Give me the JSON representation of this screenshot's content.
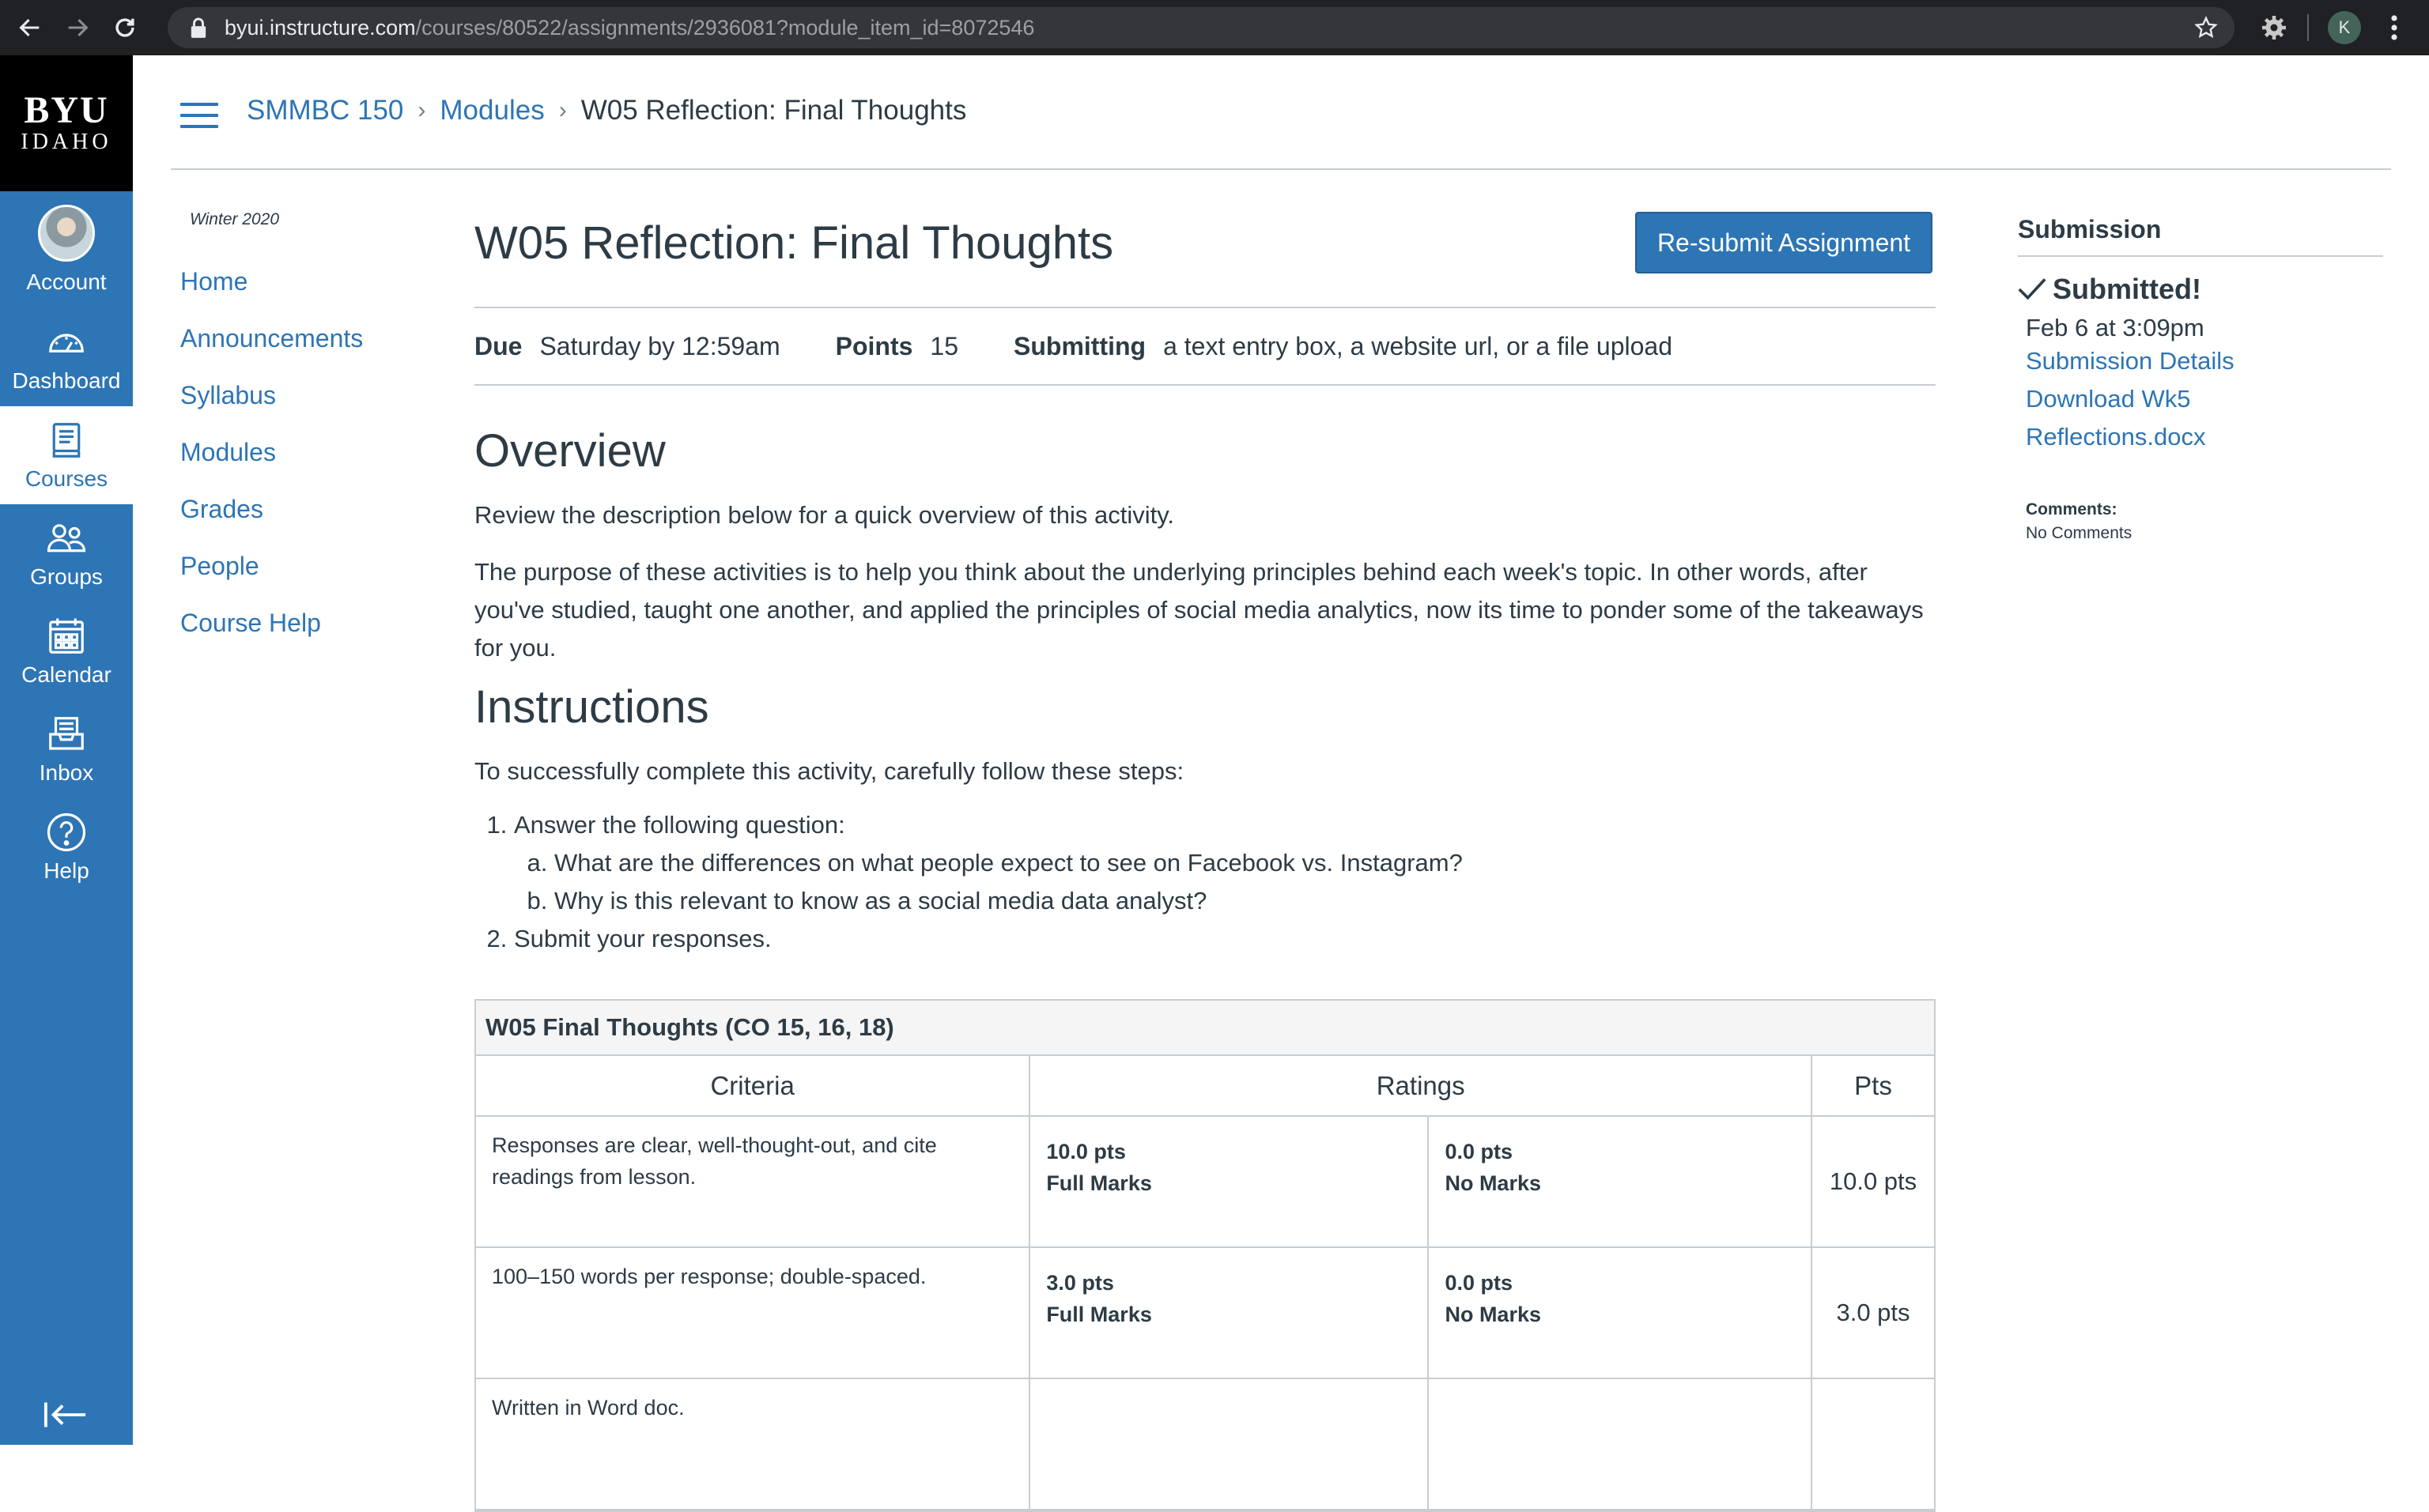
{
  "browser": {
    "url_host": "byui.instructure.com",
    "url_path": "/courses/80522/assignments/2936081?module_item_id=8072546",
    "profile_initial": "K"
  },
  "global_nav": {
    "logo_top": "BYU",
    "logo_bottom": "IDAHO",
    "items": [
      {
        "label": "Account",
        "icon": "avatar"
      },
      {
        "label": "Dashboard",
        "icon": "dashboard-icon"
      },
      {
        "label": "Courses",
        "icon": "courses-icon"
      },
      {
        "label": "Groups",
        "icon": "groups-icon"
      },
      {
        "label": "Calendar",
        "icon": "calendar-icon"
      },
      {
        "label": "Inbox",
        "icon": "inbox-icon"
      },
      {
        "label": "Help",
        "icon": "help-icon"
      }
    ],
    "active_item": "Courses"
  },
  "breadcrumb": {
    "course": "SMMBC 150",
    "section": "Modules",
    "current": "W05 Reflection: Final Thoughts"
  },
  "course_nav": {
    "term": "Winter 2020",
    "items": [
      "Home",
      "Announcements",
      "Syllabus",
      "Modules",
      "Grades",
      "People",
      "Course Help"
    ]
  },
  "assignment": {
    "title": "W05 Reflection: Final Thoughts",
    "resubmit_label": "Re-submit Assignment",
    "due_label": "Due",
    "due_value": "Saturday by 12:59am",
    "points_label": "Points",
    "points_value": "15",
    "submitting_label": "Submitting",
    "submitting_value": "a text entry box, a website url, or a file upload",
    "overview_heading": "Overview",
    "overview_p1": "Review the description below for a quick overview of this activity.",
    "overview_p2": "The purpose of these activities is to help you think about the underlying principles behind each week's topic. In other words, after you've studied, taught one another, and applied the principles of social media analytics, now its time to ponder some of the takeaways for you.",
    "instructions_heading": "Instructions",
    "instructions_intro": "To successfully complete this activity, carefully follow these steps:",
    "step1": "Answer the following question:",
    "step1a": "What are the differences on what people expect to see on Facebook vs. Instagram?",
    "step1b": "Why is this relevant to know as a social media data analyst?",
    "step2": "Submit your responses."
  },
  "rubric": {
    "title": "W05 Final Thoughts (CO 15, 16, 18)",
    "headers": {
      "criteria": "Criteria",
      "ratings": "Ratings",
      "pts": "Pts"
    },
    "rows": [
      {
        "criterion": "Responses are clear, well-thought-out, and cite readings from lesson.",
        "rating1_pts": "10.0 pts",
        "rating1_desc": "Full Marks",
        "rating2_pts": "0.0 pts",
        "rating2_desc": "No Marks",
        "pts": "10.0 pts"
      },
      {
        "criterion": "100–150 words per response; double-spaced.",
        "rating1_pts": "3.0 pts",
        "rating1_desc": "Full Marks",
        "rating2_pts": "0.0 pts",
        "rating2_desc": "No Marks",
        "pts": "3.0 pts"
      },
      {
        "criterion": "Written in Word doc.",
        "rating1_pts": "",
        "rating1_desc": "",
        "rating2_pts": "",
        "rating2_desc": "",
        "pts": ""
      }
    ]
  },
  "submission": {
    "heading": "Submission",
    "status": "Submitted!",
    "date": "Feb 6 at 3:09pm",
    "details_link": "Submission Details",
    "download_link_1": "Download Wk5",
    "download_link_2": "Reflections.docx",
    "comments_label": "Comments:",
    "comments_value": "No Comments"
  },
  "colors": {
    "brand_blue": "#2d75b5",
    "text": "#2d3b45",
    "browser_chrome": "#202124"
  }
}
